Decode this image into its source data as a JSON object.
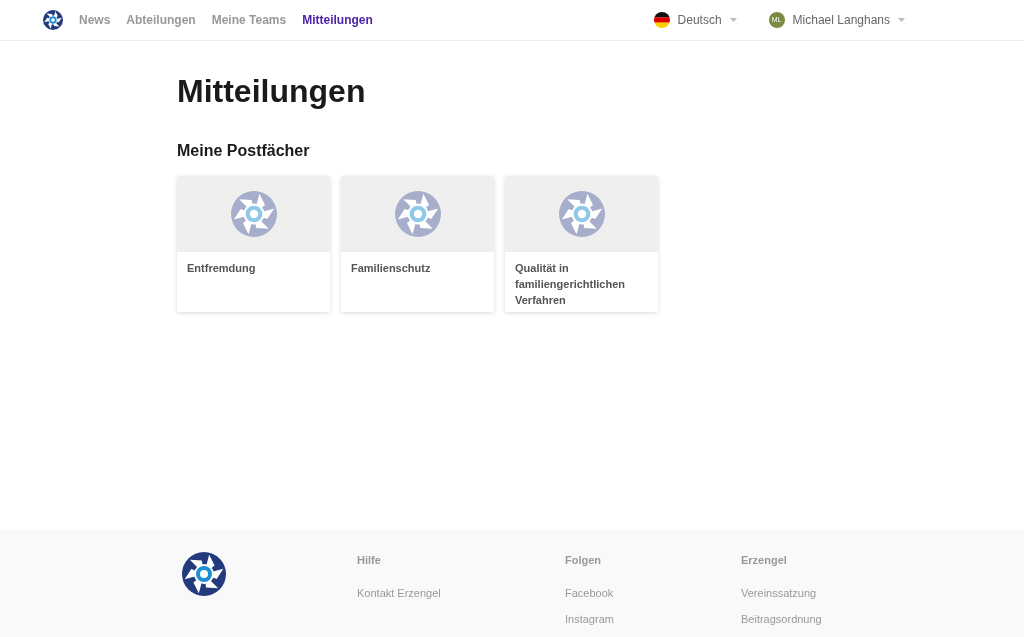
{
  "nav": {
    "links": [
      {
        "label": "News",
        "selected": false
      },
      {
        "label": "Abteilungen",
        "selected": false
      },
      {
        "label": "Meine Teams",
        "selected": false
      },
      {
        "label": "Mitteilungen",
        "selected": true
      }
    ],
    "language": "Deutsch",
    "user": {
      "initials": "ML",
      "name": "Michael Langhans"
    }
  },
  "page": {
    "title": "Mitteilungen",
    "section": "Meine Postfächer",
    "mailboxes": [
      {
        "name": "Entfremdung"
      },
      {
        "name": "Familienschutz"
      },
      {
        "name": "Qualität in familiengerichtlichen Verfahren"
      }
    ]
  },
  "footer": {
    "columns": [
      {
        "heading": "Hilfe",
        "links": [
          "Kontakt Erzengel"
        ]
      },
      {
        "heading": "Folgen",
        "links": [
          "Facebook",
          "Instagram"
        ]
      },
      {
        "heading": "Erzengel",
        "links": [
          "Vereinssatzung",
          "Beitragsordnung"
        ]
      }
    ]
  }
}
